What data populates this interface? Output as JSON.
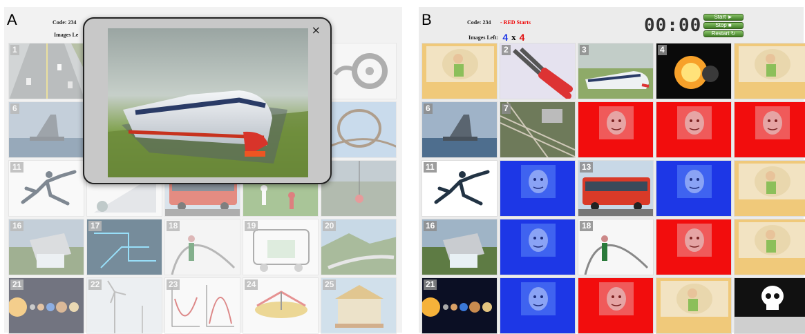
{
  "panelA": {
    "letter": "A",
    "code_label": "Code: 234",
    "images_left_label": "Images Le",
    "tiles": [
      {
        "num": "1",
        "img": "highway"
      },
      {
        "num": "",
        "img": "blank"
      },
      {
        "num": "",
        "img": "blank"
      },
      {
        "num": "",
        "img": "blank"
      },
      {
        "num": "",
        "img": "lock-dial"
      },
      {
        "num": "6",
        "img": "warship"
      },
      {
        "num": "",
        "img": "blank"
      },
      {
        "num": "",
        "img": "blank"
      },
      {
        "num": "",
        "img": "blank"
      },
      {
        "num": "0",
        "img": "rollercoaster"
      },
      {
        "num": "11",
        "img": "runner"
      },
      {
        "num": "",
        "img": "ramp"
      },
      {
        "num": "",
        "img": "bus"
      },
      {
        "num": "",
        "img": "soccer"
      },
      {
        "num": "5",
        "img": "bungee"
      },
      {
        "num": "16",
        "img": "dam"
      },
      {
        "num": "17",
        "img": "circuit"
      },
      {
        "num": "18",
        "img": "polevault"
      },
      {
        "num": "19",
        "img": "cart"
      },
      {
        "num": "20",
        "img": "train-landscape"
      },
      {
        "num": "21",
        "img": "planets"
      },
      {
        "num": "22",
        "img": "windmill"
      },
      {
        "num": "23",
        "img": "graphs"
      },
      {
        "num": "24",
        "img": "merrygoround"
      },
      {
        "num": "25",
        "img": "carousel"
      }
    ],
    "modal": {
      "close": "×",
      "image": "high-speed-train"
    }
  },
  "panelB": {
    "letter": "B",
    "code_label": "Code: 234",
    "red_starts": "- RED Starts",
    "images_left_label": "Images Left:",
    "blue_count": "4",
    "vs": "x",
    "red_count": "4",
    "timer": "00:00",
    "start_label": "Start ►",
    "stop_label": "Stop ■",
    "restart_label": "Restart ↻",
    "tiles": [
      {
        "num": "",
        "img": "cover-yellow"
      },
      {
        "num": "2",
        "img": "pliers"
      },
      {
        "num": "3",
        "img": "train"
      },
      {
        "num": "4",
        "img": "explosion"
      },
      {
        "num": "",
        "img": "cover-yellow"
      },
      {
        "num": "6",
        "img": "warship"
      },
      {
        "num": "7",
        "img": "rail-yard"
      },
      {
        "num": "",
        "img": "cover-red"
      },
      {
        "num": "",
        "img": "cover-red"
      },
      {
        "num": "",
        "img": "cover-red"
      },
      {
        "num": "11",
        "img": "runner"
      },
      {
        "num": "",
        "img": "cover-blue"
      },
      {
        "num": "13",
        "img": "bus"
      },
      {
        "num": "",
        "img": "cover-blue"
      },
      {
        "num": "",
        "img": "cover-yellow"
      },
      {
        "num": "16",
        "img": "dam"
      },
      {
        "num": "",
        "img": "cover-blue"
      },
      {
        "num": "18",
        "img": "polevault"
      },
      {
        "num": "",
        "img": "cover-red"
      },
      {
        "num": "",
        "img": "cover-yellow"
      },
      {
        "num": "21",
        "img": "planets"
      },
      {
        "num": "",
        "img": "cover-blue"
      },
      {
        "num": "",
        "img": "cover-red"
      },
      {
        "num": "",
        "img": "cover-yellow"
      },
      {
        "num": "",
        "img": "skull"
      }
    ]
  },
  "colors": {
    "blue_team": "#1d37e6",
    "red_team": "#f20d0d",
    "yellow_cover": "#f0c97a",
    "timer": "#333333",
    "button": "#4f8f30"
  }
}
